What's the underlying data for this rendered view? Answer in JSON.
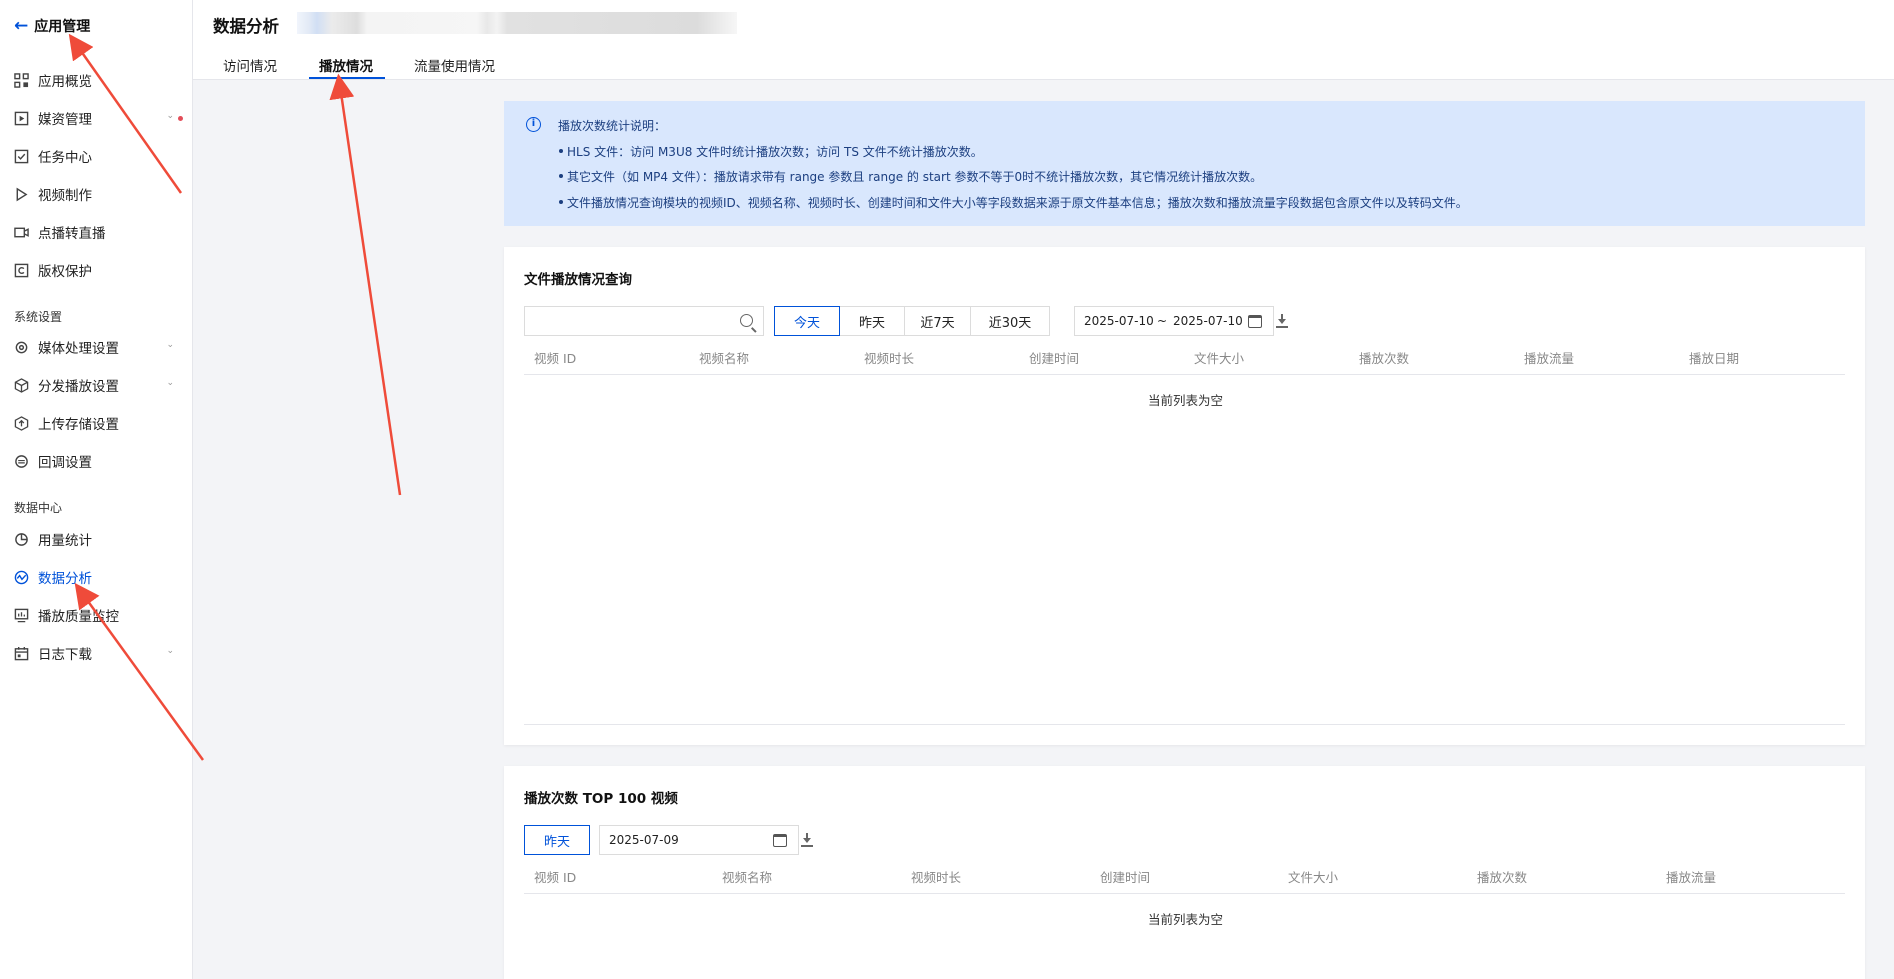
{
  "sidebar": {
    "back_title": "应用管理",
    "items_top": [
      {
        "label": "应用概览"
      },
      {
        "label": "媒资管理"
      },
      {
        "label": "任务中心"
      },
      {
        "label": "视频制作"
      },
      {
        "label": "点播转直播"
      },
      {
        "label": "版权保护"
      }
    ],
    "group_system": "系统设置",
    "items_system": [
      {
        "label": "媒体处理设置"
      },
      {
        "label": "分发播放设置"
      },
      {
        "label": "上传存储设置"
      },
      {
        "label": "回调设置"
      }
    ],
    "group_data": "数据中心",
    "items_data": [
      {
        "label": "用量统计"
      },
      {
        "label": "数据分析"
      },
      {
        "label": "播放质量监控"
      },
      {
        "label": "日志下载"
      }
    ]
  },
  "header": {
    "title": "数据分析",
    "tabs": [
      {
        "label": "访问情况"
      },
      {
        "label": "播放情况"
      },
      {
        "label": "流量使用情况"
      }
    ]
  },
  "notice": {
    "title": "播放次数统计说明：",
    "lines": [
      "HLS 文件：访问 M3U8 文件时统计播放次数；访问 TS 文件不统计播放次数。",
      "其它文件（如 MP4 文件）：播放请求带有 range 参数且 range 的 start 参数不等于0时不统计播放次数，其它情况统计播放次数。",
      "文件播放情况查询模块的视频ID、视频名称、视频时长、创建时间和文件大小等字段数据来源于原文件基本信息；播放次数和播放流量字段数据包含原文件以及转码文件。"
    ]
  },
  "query": {
    "title": "文件播放情况查询",
    "search_placeholder": "",
    "ranges": [
      {
        "label": "今天"
      },
      {
        "label": "昨天"
      },
      {
        "label": "近7天"
      },
      {
        "label": "近30天"
      }
    ],
    "date_start": "2025-07-10",
    "date_sep": "~",
    "date_end": "2025-07-10",
    "columns": [
      "视频 ID",
      "视频名称",
      "视频时长",
      "创建时间",
      "文件大小",
      "播放次数",
      "播放流量",
      "播放日期"
    ],
    "empty": "当前列表为空"
  },
  "top100": {
    "title": "播放次数 TOP 100 视频",
    "range": "昨天",
    "date": "2025-07-09",
    "columns": [
      "视频 ID",
      "视频名称",
      "视频时长",
      "创建时间",
      "文件大小",
      "播放次数",
      "播放流量"
    ],
    "empty": "当前列表为空"
  },
  "colors": {
    "accent": "#0052d9",
    "notice_bg": "#d9e7fd",
    "annotation_arrow": "#ef4b3a"
  }
}
